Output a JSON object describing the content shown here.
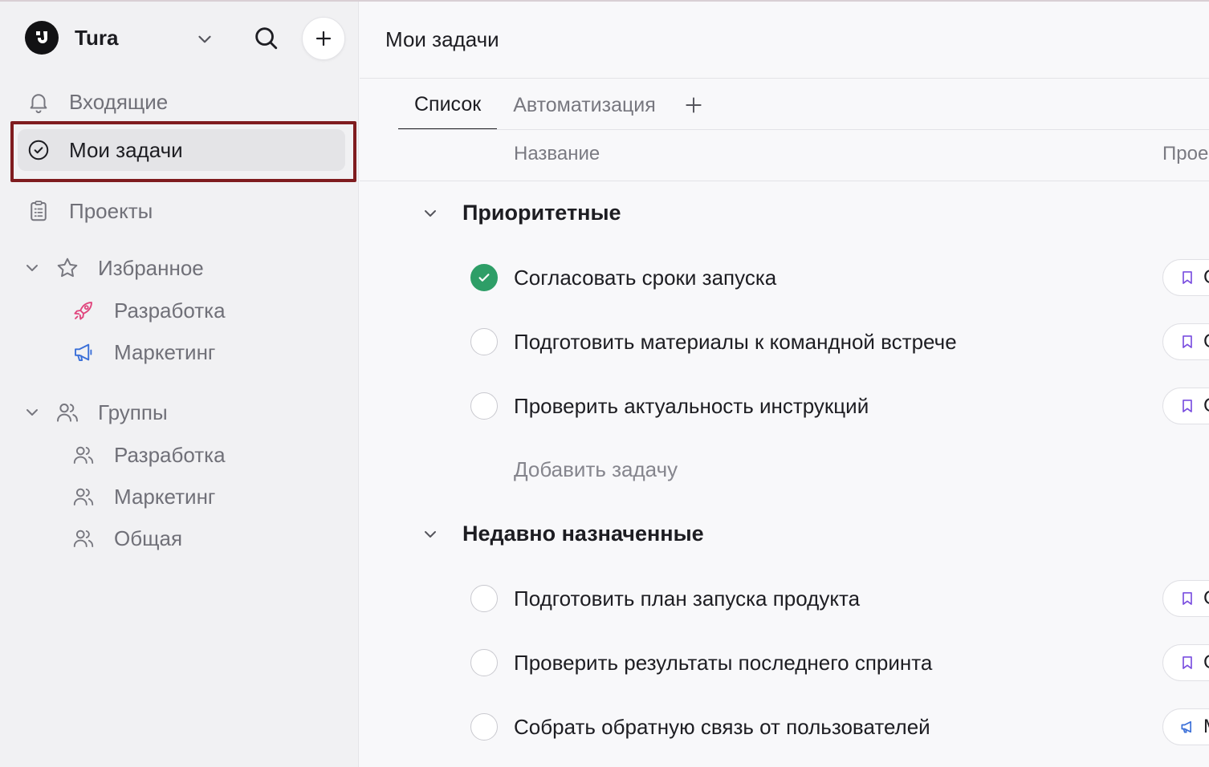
{
  "workspace": {
    "name": "Tura"
  },
  "sidebar": {
    "nav": [
      {
        "label": "Входящие",
        "icon": "bell-icon"
      },
      {
        "label": "Мои задачи",
        "icon": "check-circle-icon",
        "active": true
      },
      {
        "label": "Проекты",
        "icon": "clipboard-icon"
      }
    ],
    "favorites": {
      "label": "Избранное",
      "items": [
        {
          "label": "Разработка",
          "icon": "rocket-icon",
          "color": "#e0447c"
        },
        {
          "label": "Маркетинг",
          "icon": "megaphone-icon",
          "color": "#3a6fd8"
        }
      ]
    },
    "groups": {
      "label": "Группы",
      "items": [
        {
          "label": "Разработка",
          "icon": "users-icon"
        },
        {
          "label": "Маркетинг",
          "icon": "users-icon"
        },
        {
          "label": "Общая",
          "icon": "users-icon"
        }
      ]
    }
  },
  "main": {
    "title": "Мои задачи",
    "tabs": [
      {
        "label": "Список",
        "active": true
      },
      {
        "label": "Автоматизация",
        "active": false
      }
    ],
    "columns": {
      "name": "Название",
      "project": "Прое"
    },
    "groups": [
      {
        "title": "Приоритетные",
        "tasks": [
          {
            "name": "Согласовать сроки запуска",
            "done": true,
            "project_initial": "С",
            "project_icon": "bookmark-icon"
          },
          {
            "name": "Подготовить материалы к командной встрече",
            "done": false,
            "project_initial": "С",
            "project_icon": "bookmark-icon"
          },
          {
            "name": "Проверить актуальность инструкций",
            "done": false,
            "project_initial": "С",
            "project_icon": "bookmark-icon"
          }
        ],
        "add_task_label": "Добавить задачу"
      },
      {
        "title": "Недавно назначенные",
        "tasks": [
          {
            "name": "Подготовить план запуска продукта",
            "done": false,
            "project_initial": "С",
            "project_icon": "bookmark-icon"
          },
          {
            "name": "Проверить результаты последнего спринта",
            "done": false,
            "project_initial": "С",
            "project_icon": "bookmark-icon"
          },
          {
            "name": "Собрать обратную связь от пользователей",
            "done": false,
            "project_initial": "М",
            "project_icon": "megaphone-icon"
          }
        ]
      }
    ]
  },
  "colors": {
    "accent_done": "#2e9e67",
    "highlight_border": "#7f1c1f",
    "bookmark": "#7a4ee0",
    "megaphone": "#3a6fd8",
    "rocket": "#e0447c"
  }
}
